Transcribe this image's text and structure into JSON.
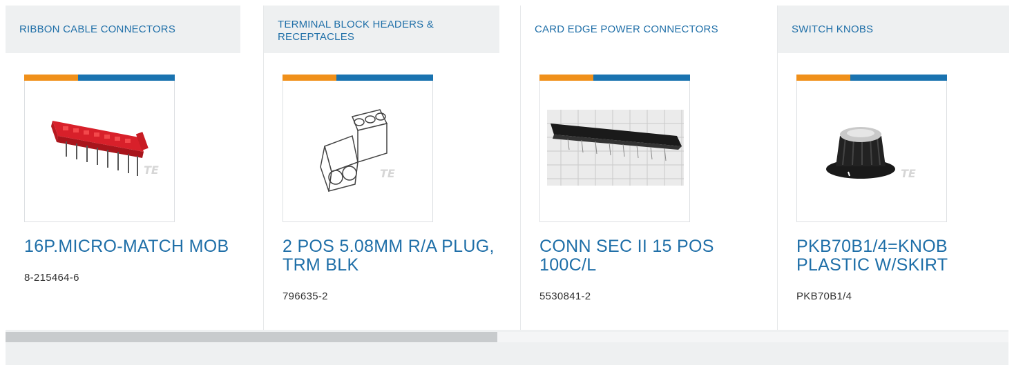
{
  "products": [
    {
      "category": "RIBBON CABLE CONNECTORS",
      "title": "16P.MICRO-MATCH MOB",
      "part_number": "8-215464-6",
      "image_icon": "ribbon-connector-image"
    },
    {
      "category": "TERMINAL BLOCK HEADERS & RECEPTACLES",
      "title": "2 POS 5.08MM R/A PLUG, TRM BLK",
      "part_number": "796635-2",
      "image_icon": "terminal-block-image"
    },
    {
      "category": "CARD EDGE POWER CONNECTORS",
      "title": "CONN SEC II 15 POS 100C/L",
      "part_number": "5530841-2",
      "image_icon": "card-edge-connector-image"
    },
    {
      "category": "SWITCH KNOBS",
      "title": "PKB70B1/4=KNOB PLASTIC W/SKIRT",
      "part_number": "PKB70B1/4",
      "image_icon": "knob-image"
    }
  ],
  "watermark": "TE",
  "colors": {
    "accent_orange": "#f0901a",
    "accent_blue": "#1a73b0",
    "link": "#1f6fa8"
  }
}
